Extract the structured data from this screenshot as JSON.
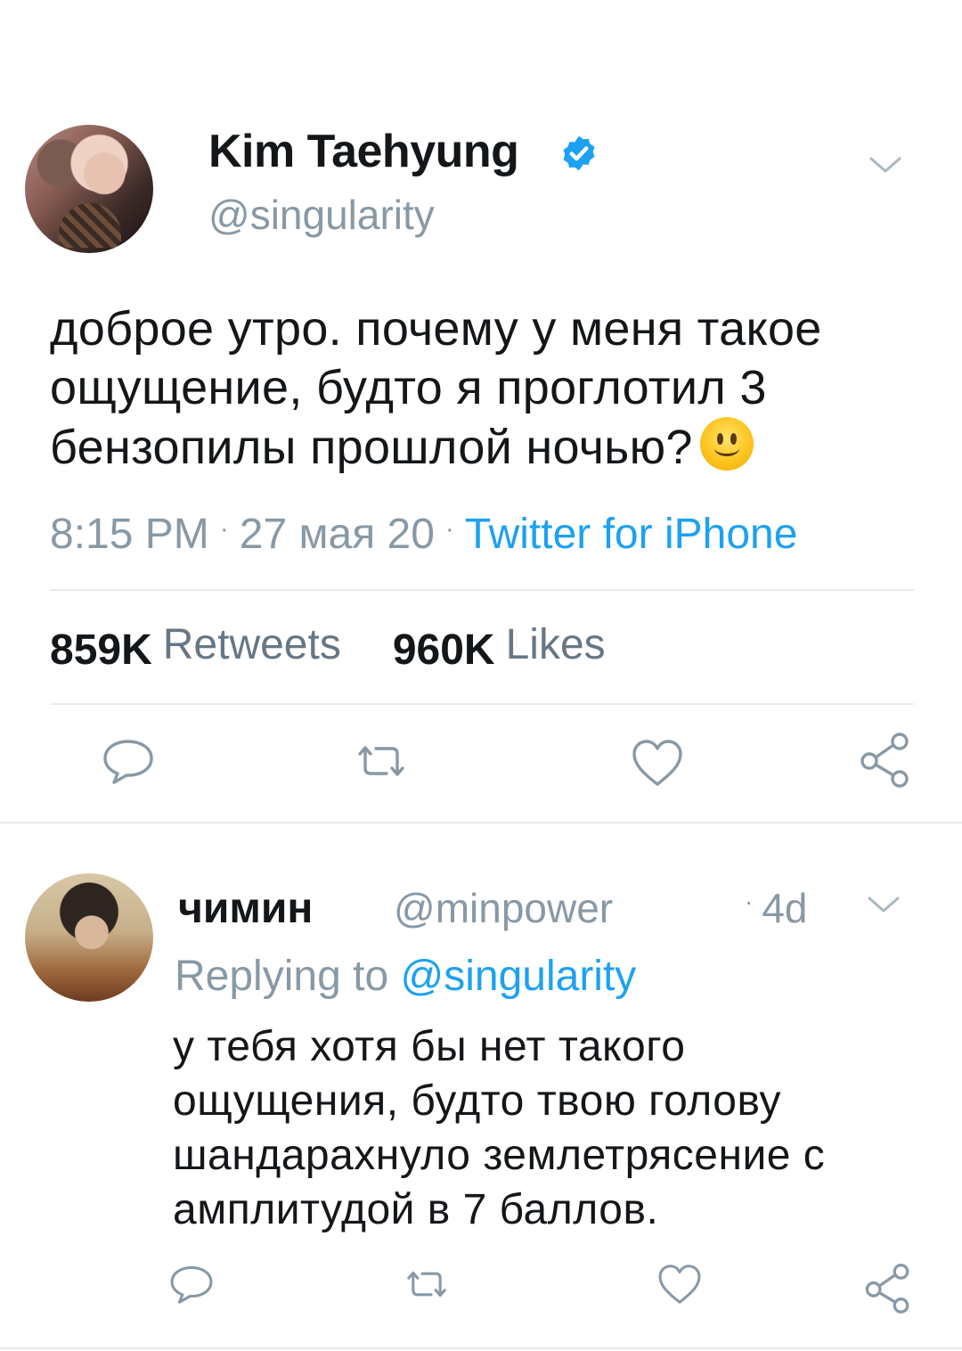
{
  "main_tweet": {
    "author_name": "Kim Taehyung",
    "handle": "@singularity",
    "verified_icon": "verified-badge-icon",
    "text": "доброе утро. почему у меня такое ощущение, будто я проглотил 3 бензопилы прошлой ночью?",
    "emoji": "slightly-smiling-face",
    "time": "8:15 PM",
    "date": "27 мая 20",
    "source": "Twitter for iPhone",
    "separator": "·",
    "retweets_count": "859K",
    "retweets_label": "Retweets",
    "likes_count": "960K",
    "likes_label": "Likes"
  },
  "reply_tweet": {
    "author_name": "чимин",
    "handle": "@minpower",
    "time_ago": "4d",
    "separator": "·",
    "replying_prefix": "Replying to",
    "replying_to": "@singularity",
    "text": "у тебя хотя бы нет такого ощущения, будто твою голову шандарахнуло землетрясение с амплитудой в 7 баллов."
  },
  "colors": {
    "accent": "#1da1f2",
    "muted": "#8899a6",
    "text": "#14171a",
    "divider": "#e6ecf0"
  },
  "icons": [
    "reply-icon",
    "retweet-icon",
    "like-icon",
    "share-icon",
    "chevron-down-icon",
    "verified-badge-icon"
  ]
}
